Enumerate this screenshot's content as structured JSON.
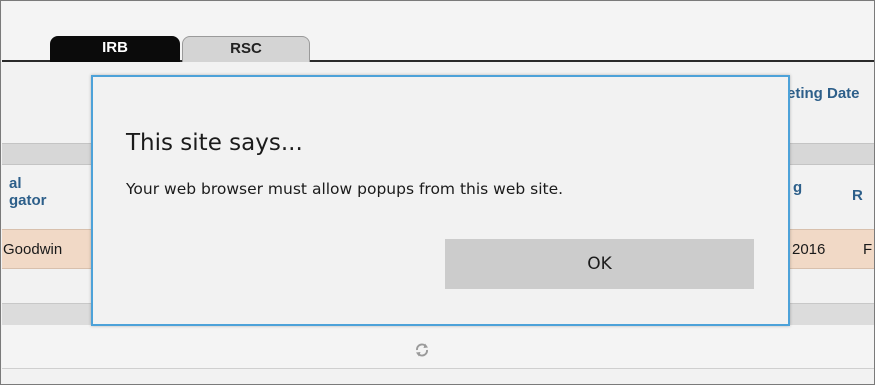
{
  "tabs": [
    {
      "label": "IRB",
      "active": true
    },
    {
      "label": "RSC",
      "active": false
    }
  ],
  "background_table": {
    "meeting_date_header_partial": "eting Date",
    "column_header_left_partial": [
      "al",
      "gator"
    ],
    "column_header_right_partial": [
      "g",
      "R"
    ],
    "row_cells_partial": {
      "left": "Goodwin",
      "middle": "2016",
      "right": "F"
    },
    "footer_icon": "refresh-icon"
  },
  "dialog": {
    "title": "This site says...",
    "message": "Your web browser must allow popups from this web site.",
    "ok_label": "OK",
    "border_color": "#4da2d9"
  },
  "colors": {
    "row_highlight": "#f1d9c6",
    "header_text": "#2d5f8a",
    "active_tab": "#0b0b0b"
  }
}
